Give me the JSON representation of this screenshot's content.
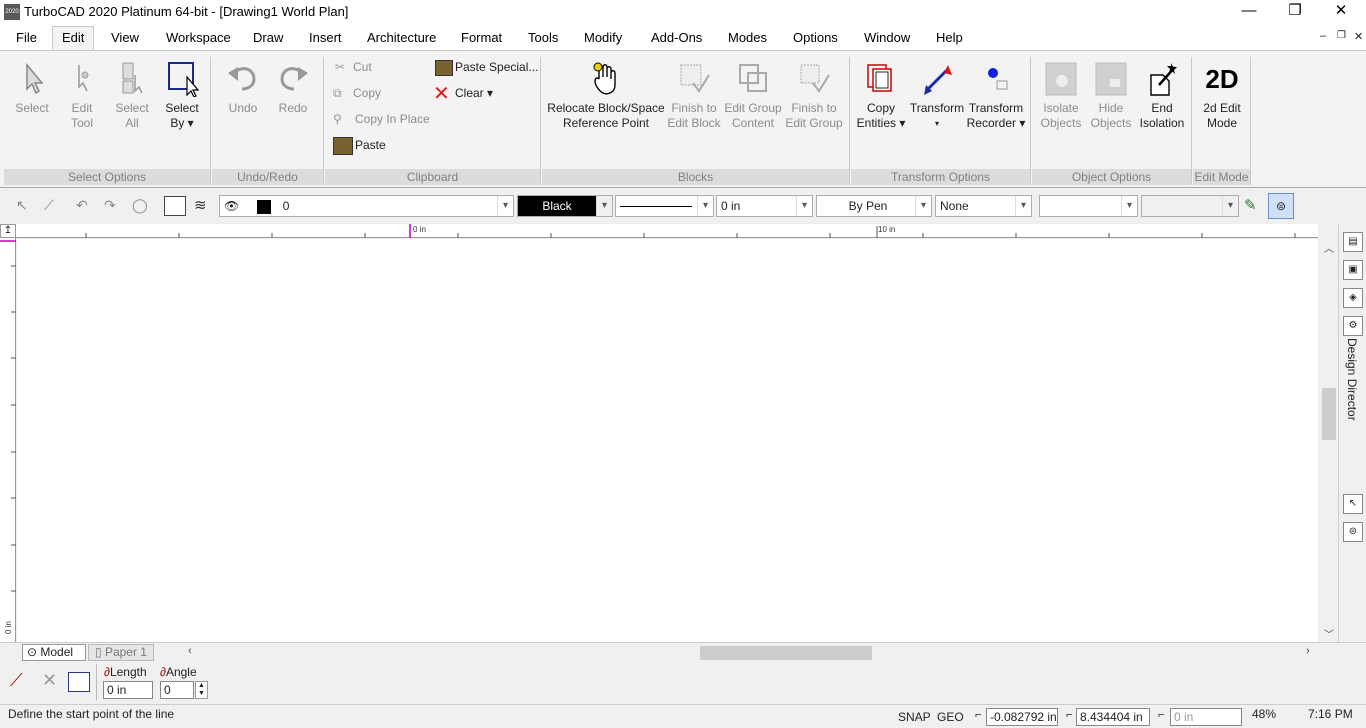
{
  "window": {
    "title": "TurboCAD 2020 Platinum 64-bit - [Drawing1 World Plan]",
    "app_icon_text": "2020",
    "minimize": "—",
    "restore": "❐",
    "close": "✕"
  },
  "menubar": {
    "items": [
      "File",
      "Edit",
      "View",
      "Workspace",
      "Draw",
      "Insert",
      "Architecture",
      "Format",
      "Tools",
      "Modify",
      "Add-Ons",
      "Modes",
      "Options",
      "Window",
      "Help"
    ],
    "active": "Edit",
    "mdi_controls": [
      "–",
      "❐",
      "✕"
    ]
  },
  "ribbon": {
    "groups": {
      "select_options": {
        "label": "Select Options",
        "buttons": [
          {
            "label1": "Select",
            "label2": "",
            "icon": "cursor-arrow-icon"
          },
          {
            "label1": "Edit",
            "label2": "Tool",
            "icon": "edit-tool-icon"
          },
          {
            "label1": "Select",
            "label2": "All",
            "icon": "select-all-icon"
          },
          {
            "label1": "Select",
            "label2": "By ▾",
            "icon": "select-by-icon"
          }
        ]
      },
      "undo_redo": {
        "label": "Undo/Redo",
        "buttons": [
          {
            "label": "Undo"
          },
          {
            "label": "Redo"
          }
        ]
      },
      "clipboard": {
        "label": "Clipboard",
        "cut": "Cut",
        "copy": "Copy",
        "copy_in_place": "Copy In Place",
        "paste": "Paste",
        "paste_special": "Paste Special...",
        "clear": "Clear ▾"
      },
      "blocks": {
        "label": "Blocks",
        "buttons": [
          {
            "label1": "Relocate Block/Space",
            "label2": "Reference Point"
          },
          {
            "label1": "Finish to",
            "label2": "Edit Block"
          },
          {
            "label1": "Edit Group",
            "label2": "Content"
          },
          {
            "label1": "Finish to",
            "label2": "Edit Group"
          }
        ]
      },
      "transform_options": {
        "label": "Transform Options",
        "buttons": [
          {
            "label1": "Copy",
            "label2": "Entities ▾"
          },
          {
            "label1": "Transform",
            "label2": "▾"
          },
          {
            "label1": "Transform",
            "label2": "Recorder ▾"
          }
        ]
      },
      "object_options": {
        "label": "Object Options",
        "buttons": [
          {
            "label1": "Isolate",
            "label2": "Objects"
          },
          {
            "label1": "Hide",
            "label2": "Objects"
          },
          {
            "label1": "End",
            "label2": "Isolation"
          }
        ]
      },
      "edit_mode": {
        "label": "Edit Mode",
        "icon_text": "2D",
        "buttons": [
          {
            "label1": "2d Edit",
            "label2": "Mode"
          }
        ]
      }
    }
  },
  "property_toolbar": {
    "layer_value": "0",
    "color_value": "Black",
    "line_width": "0 in",
    "pen_style": "By Pen",
    "fill": "None",
    "colors": {
      "black": "#000000"
    }
  },
  "drawing": {
    "ruler_labels": [
      "0 in",
      "10 in"
    ],
    "left_ruler_label": "0 in"
  },
  "right_panel": {
    "design_director": "Design Director"
  },
  "tabs": {
    "model": "Model",
    "paper": "Paper 1"
  },
  "inspector": {
    "length_label": "Length",
    "angle_label": "Angle",
    "length_value": "0 in",
    "angle_value": "0"
  },
  "status": {
    "prompt": "Define the start point of the line",
    "snap": "SNAP",
    "geo": "GEO",
    "x_value": "-0.082792 in",
    "y_value": "8.434404 in",
    "z_value": "0 in",
    "zoom": "48%",
    "time": "7:16 PM"
  }
}
